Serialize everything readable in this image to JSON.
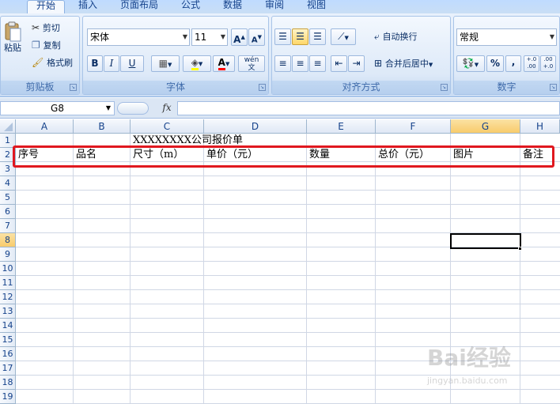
{
  "tabs": [
    "开始",
    "插入",
    "页面布局",
    "公式",
    "数据",
    "审阅",
    "视图"
  ],
  "clipboard": {
    "paste": "粘贴",
    "cut": "剪切",
    "copy": "复制",
    "format_painter": "格式刷",
    "label": "剪贴板"
  },
  "font": {
    "name": "宋体",
    "size": "11",
    "grow": "A",
    "shrink": "A",
    "bold": "B",
    "italic": "I",
    "underline": "U",
    "pinyin": "wén",
    "label": "字体"
  },
  "alignment": {
    "wrap_text": "自动换行",
    "merge_center": "合并后居中",
    "label": "对齐方式"
  },
  "number": {
    "format": "常规",
    "percent": "%",
    "comma": ",",
    "inc_decimal": "+.0 .00",
    "dec_decimal": ".00 +.0",
    "label": "数字"
  },
  "formula_bar": {
    "name_box": "G8",
    "fx": "fx",
    "value": ""
  },
  "columns": [
    "A",
    "B",
    "C",
    "D",
    "E",
    "F",
    "G",
    "H"
  ],
  "rows": [
    "1",
    "2",
    "3",
    "4",
    "5",
    "6",
    "7",
    "8",
    "9",
    "10",
    "11",
    "12",
    "13",
    "14",
    "15",
    "16",
    "17",
    "18",
    "19"
  ],
  "sheet": {
    "title": "XXXXXXXX公司报价单",
    "headers": [
      "序号",
      "品名",
      "尺寸（m）",
      "单价（元）",
      "数量",
      "总价（元）",
      "图片",
      "备注"
    ]
  },
  "watermark": {
    "brand": "Bai经验",
    "url": "jingyan.baidu.com"
  },
  "colors": {
    "highlight_box": "#e0181f",
    "selected_header": "#f8cb6b",
    "ribbon": "#dbe8f7"
  }
}
